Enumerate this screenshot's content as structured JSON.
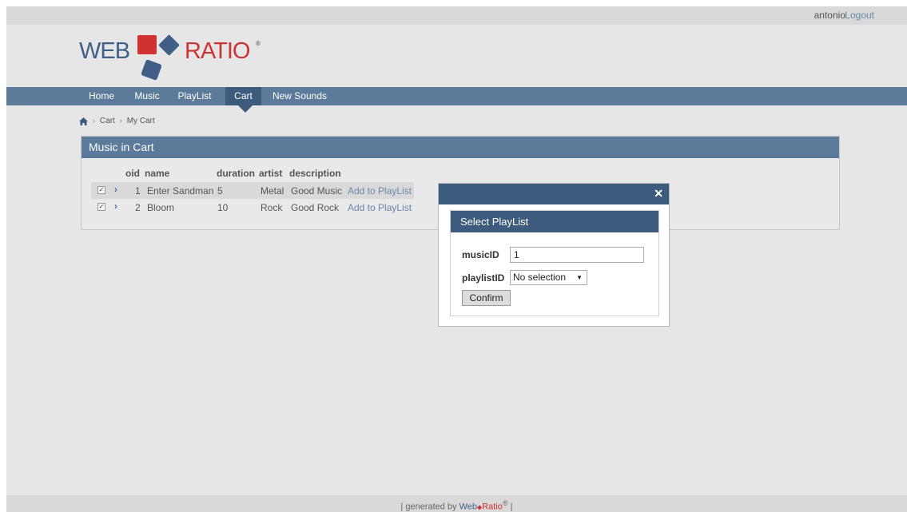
{
  "topbar": {
    "user": "antonio",
    "logout": "Logout"
  },
  "logo": {
    "left": "WEB",
    "right": "RATIO",
    "mark": "®"
  },
  "nav": {
    "items": [
      "Home",
      "Music",
      "PlayList",
      "Cart",
      "New Sounds"
    ],
    "active": "Cart"
  },
  "breadcrumb": {
    "home_icon": "home-icon",
    "items": [
      "Cart",
      "My Cart"
    ]
  },
  "panel": {
    "title": "Music in Cart",
    "columns": [
      "oid",
      "name",
      "duration",
      "artist",
      "description"
    ],
    "rows": [
      {
        "oid": "1",
        "name": "Enter Sandman",
        "duration": "5",
        "artist": "Metal",
        "description": "Good Music",
        "action": "Add to PlayList",
        "checked": true
      },
      {
        "oid": "2",
        "name": "Bloom",
        "duration": "10",
        "artist": "Rock",
        "description": "Good Rock",
        "action": "Add to PlayList",
        "checked": true
      }
    ]
  },
  "dialog": {
    "close": "✕",
    "title": "Select PlayList",
    "musicID_label": "musicID",
    "musicID_value": "1",
    "playlistID_label": "playlistID",
    "playlistID_value": "No selection",
    "confirm": "Confirm"
  },
  "footer": {
    "prefix": "| generated by",
    "brand_left": "Web",
    "brand_right": "Ratio",
    "reg": "®",
    "suffix": "|"
  },
  "colors": {
    "nav": "#5c7a9a",
    "nav_active": "#3c5b7d",
    "link": "#6b86a8",
    "brand_red": "#cc3333",
    "brand_blue": "#3f5f86"
  }
}
